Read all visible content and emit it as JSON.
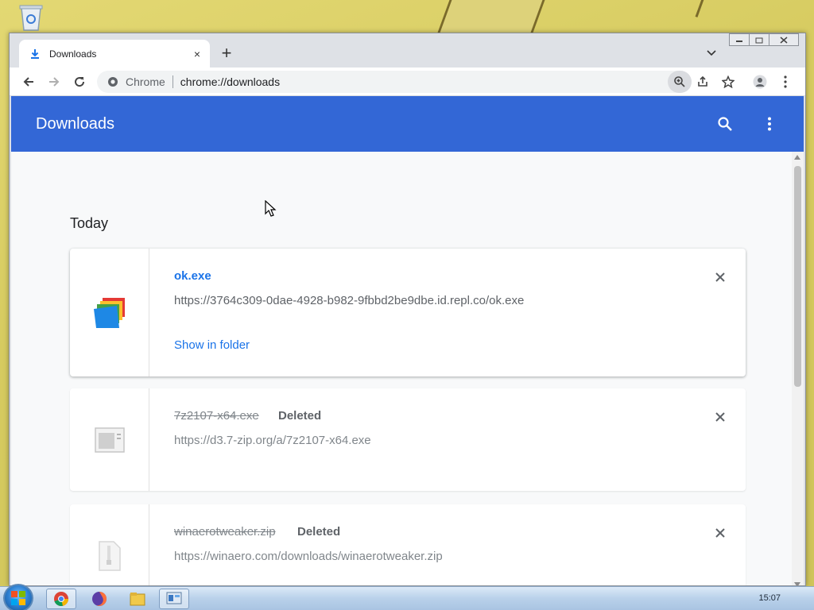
{
  "browser": {
    "tab": {
      "title": "Downloads",
      "icon": "download-icon",
      "close_label": "×"
    },
    "new_tab_label": "+",
    "omnibox": {
      "chip": "Chrome",
      "url": "chrome://downloads"
    }
  },
  "downloads_page": {
    "title": "Downloads",
    "section_date": "Today",
    "items": [
      {
        "name": "ok.exe",
        "status": "",
        "url": "https://3764c309-0dae-4928-b982-9fbbd2be9dbe.id.repl.co/ok.exe",
        "action": "Show in folder",
        "icon": "exe-program-icon"
      },
      {
        "name": "7z2107-x64.exe",
        "status": "Deleted",
        "url": "https://d3.7-zip.org/a/7z2107-x64.exe",
        "action": "",
        "icon": "generic-exe-icon"
      },
      {
        "name": "winaerotweaker.zip",
        "status": "Deleted",
        "url": "https://winaero.com/downloads/winaerotweaker.zip",
        "action": "",
        "icon": "zip-file-icon"
      }
    ]
  },
  "taskbar": {
    "clock": "15:07",
    "items": [
      "chrome-icon",
      "firefox-icon",
      "file-explorer-icon",
      "control-panel-icon"
    ]
  },
  "colors": {
    "header_blue": "#3367d6",
    "link_blue": "#1a73e8",
    "page_bg": "#f8f9fa"
  }
}
